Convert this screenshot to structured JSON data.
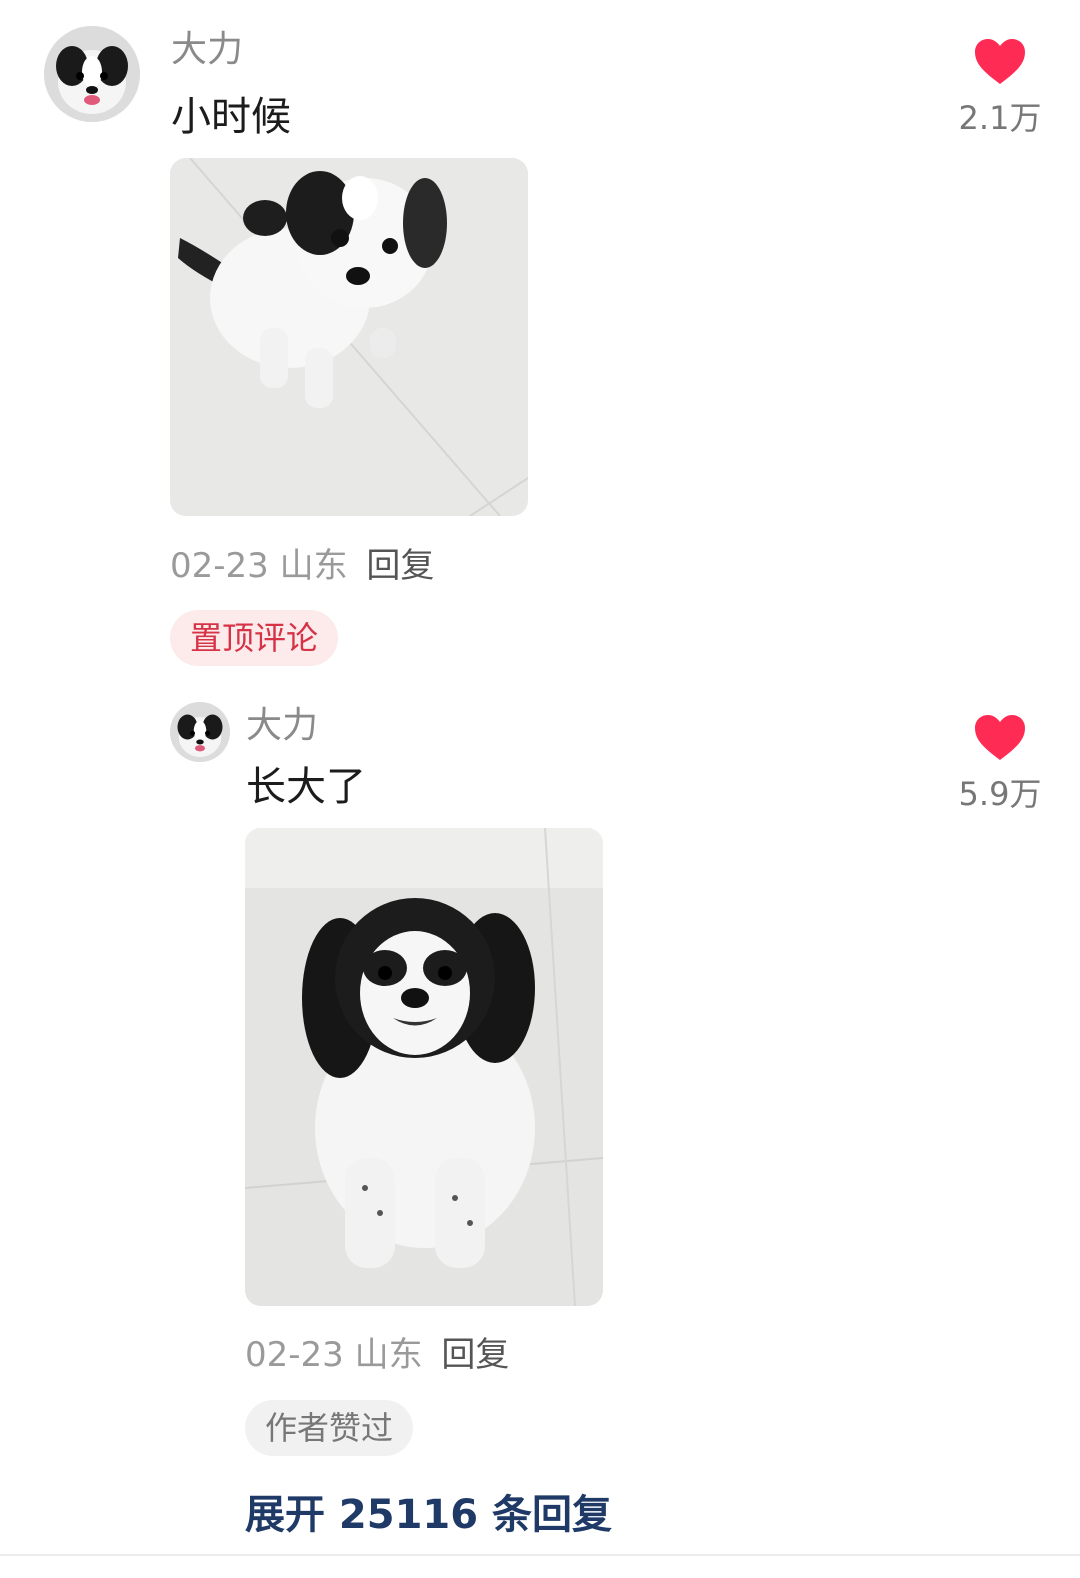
{
  "comment": {
    "username": "大力",
    "text": "小时候",
    "date": "02-23",
    "location": "山东",
    "reply_label": "回复",
    "badge": "置顶评论",
    "likes": "2.1万",
    "icons": {
      "like": "heart-icon",
      "avatar": "avatar"
    },
    "colors": {
      "heart": "#fe2c55",
      "badge_text": "#d63347"
    }
  },
  "reply": {
    "username": "大力",
    "text": "长大了",
    "date": "02-23",
    "location": "山东",
    "reply_label": "回复",
    "badge": "作者赞过",
    "likes": "5.9万"
  },
  "expand_replies": "展开 25116 条回复"
}
